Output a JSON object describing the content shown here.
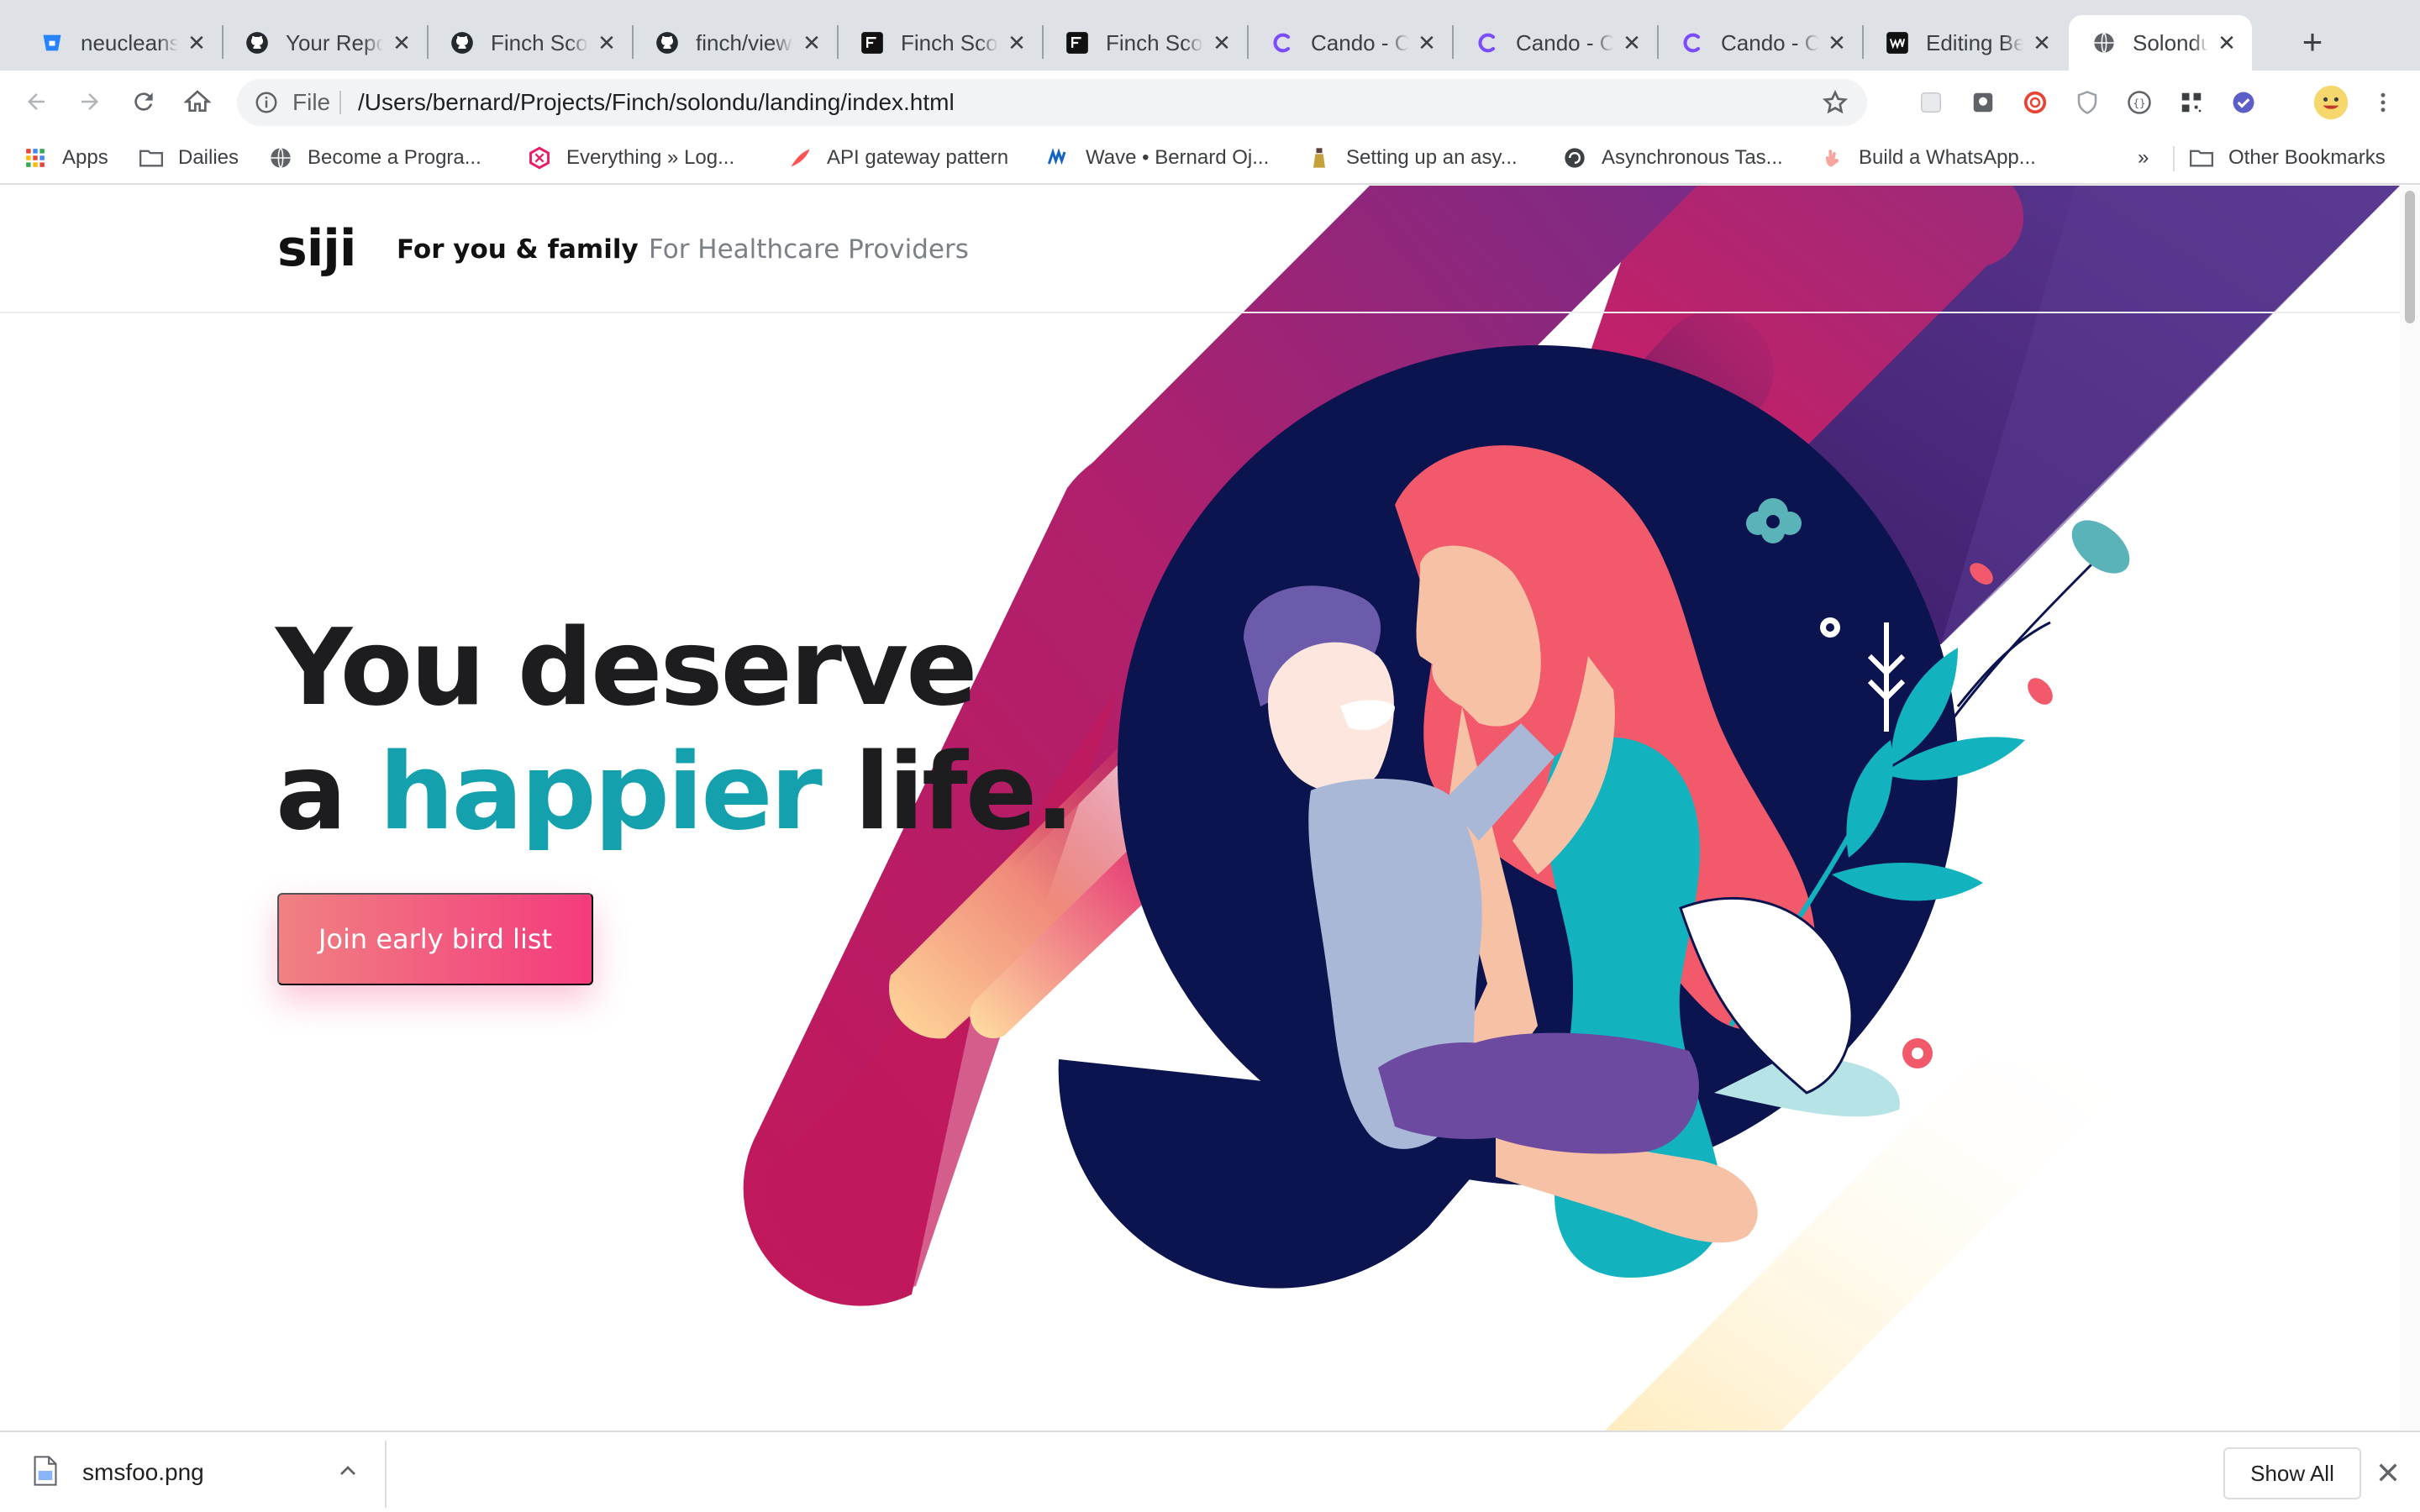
{
  "browser": {
    "tabs": [
      {
        "title": "neucleans",
        "icon": "bitbucket-icon"
      },
      {
        "title": "Your Repo",
        "icon": "github-icon"
      },
      {
        "title": "Finch Scor",
        "icon": "github-icon"
      },
      {
        "title": "finch/view",
        "icon": "github-icon"
      },
      {
        "title": "Finch Scor",
        "icon": "finch-icon"
      },
      {
        "title": "Finch Scor",
        "icon": "finch-icon"
      },
      {
        "title": "Cando - C",
        "icon": "cando-icon"
      },
      {
        "title": "Cando - C",
        "icon": "cando-icon"
      },
      {
        "title": "Cando - C",
        "icon": "cando-icon"
      },
      {
        "title": "Editing Be",
        "icon": "webflow-icon"
      },
      {
        "title": "Solondu -",
        "icon": "globe-icon",
        "active": true
      }
    ],
    "address": {
      "scheme": "File",
      "url": "/Users/bernard/Projects/Finch/solondu/landing/index.html"
    },
    "bookmarks": [
      {
        "label": "Apps",
        "icon": "apps-grid-icon"
      },
      {
        "label": "Dailies",
        "icon": "folder-icon"
      },
      {
        "label": "Become a Progra...",
        "icon": "globe-icon"
      },
      {
        "label": "Everything » Log...",
        "icon": "hexagon-icon"
      },
      {
        "label": "API gateway pattern",
        "icon": "feather-icon"
      },
      {
        "label": "Wave • Bernard Oj...",
        "icon": "wave-icon"
      },
      {
        "label": "Setting up an asy...",
        "icon": "bottle-icon"
      },
      {
        "label": "Asynchronous Tas...",
        "icon": "python-icon"
      },
      {
        "label": "Build a WhatsApp...",
        "icon": "hand-icon"
      }
    ],
    "bookmarks_overflow": "»",
    "other_bookmarks": "Other Bookmarks"
  },
  "page": {
    "logo": "siji",
    "nav": {
      "family": "For you & family",
      "providers": "For Healthcare Providers"
    },
    "headline": {
      "line1": "You deserve",
      "line2_pre": "a ",
      "line2_accent": "happier",
      "line2_post": " life."
    },
    "cta_label": "Join early bird list",
    "colors": {
      "accent": "#14a0ad",
      "cta_start": "#f08182",
      "cta_end": "#f43b7d",
      "navy": "#0c1450"
    }
  },
  "downloads": {
    "file_name": "smsfoo.png",
    "show_all": "Show All"
  }
}
